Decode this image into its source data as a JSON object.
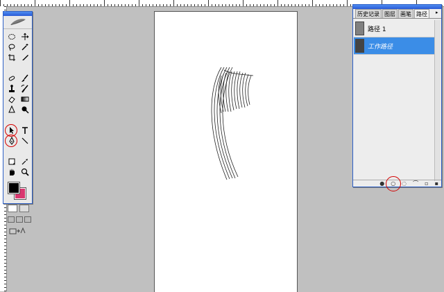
{
  "app": {
    "name": "Photoshop"
  },
  "panel": {
    "tabs": [
      "历史记录",
      "图层",
      "画笔",
      "路径"
    ],
    "active_tab": "路径",
    "paths": [
      {
        "name": "路径 1",
        "selected": false
      },
      {
        "name": "工作路径",
        "selected": true
      }
    ],
    "footer_buttons": [
      "fill-path-icon",
      "stroke-path-icon",
      "load-selection-icon",
      "make-work-path-icon",
      "new-path-icon",
      "delete-path-icon"
    ],
    "highlighted_button": "stroke-path-icon"
  },
  "toolbox": {
    "tools": [
      "marquee-icon",
      "move-icon",
      "lasso-icon",
      "magic-wand-icon",
      "crop-icon",
      "slice-icon",
      "healing-brush-icon",
      "brush-icon",
      "clone-stamp-icon",
      "history-brush-icon",
      "eraser-icon",
      "gradient-icon",
      "blur-icon",
      "dodge-icon",
      "path-selection-icon",
      "type-icon",
      "pen-icon",
      "line-icon",
      "notes-icon",
      "eyedropper-icon",
      "hand-icon",
      "zoom-icon"
    ],
    "circled_tools": [
      "path-selection-icon",
      "pen-icon"
    ],
    "foreground_color": "#000000",
    "background_color": "#d9386f"
  },
  "colors": {
    "highlight_ring": "#d40000",
    "selection": "#3b8de7",
    "title_bar": "#2a5ad6"
  }
}
